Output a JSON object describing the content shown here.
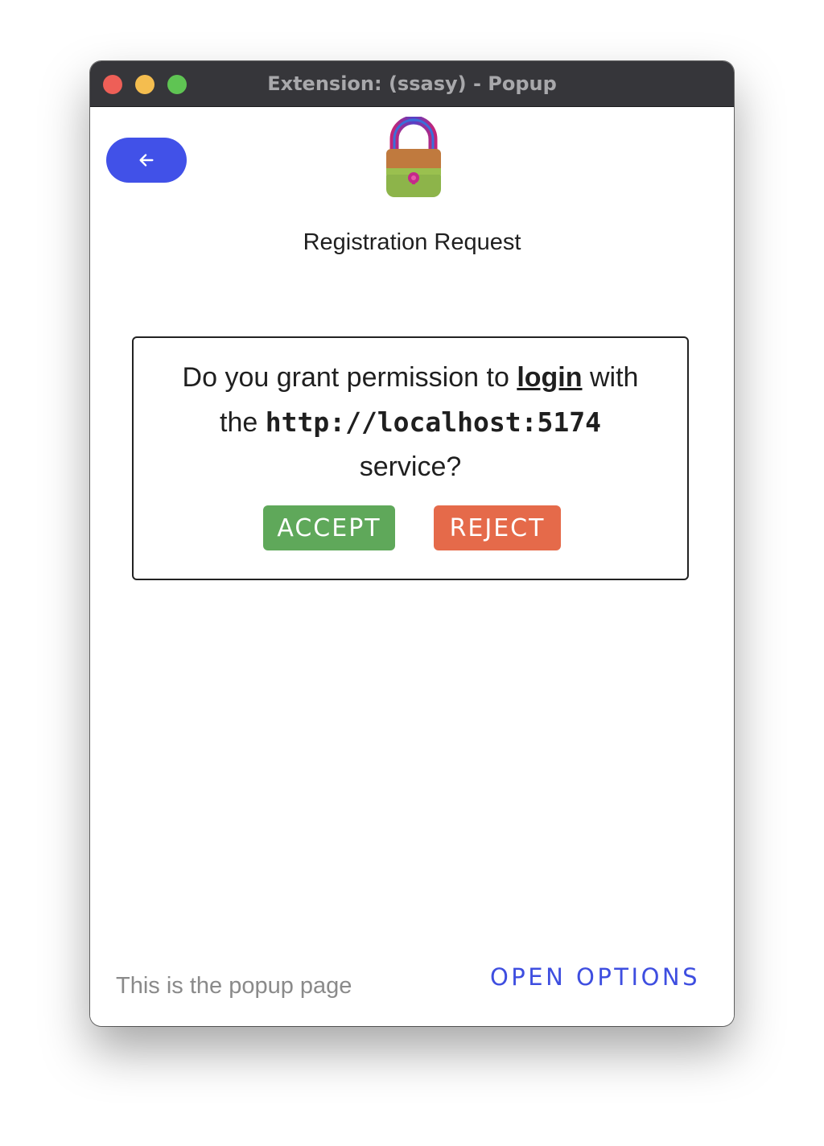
{
  "window": {
    "title": "Extension: (ssasy) - Popup"
  },
  "header": {
    "back_icon": "arrow-left-icon",
    "logo_icon": "padlock-icon",
    "heading": "Registration Request"
  },
  "dialog": {
    "question_prefix": "Do you grant permission to",
    "action": "login",
    "question_mid_1": "with",
    "question_mid_2": "the",
    "service_url": "http://localhost:5174",
    "question_suffix": "service?",
    "accept_label": "ACCEPT",
    "reject_label": "REJECT"
  },
  "footer": {
    "text": "This is the popup page",
    "options_label": "OPEN OPTIONS"
  },
  "colors": {
    "accent": "#4151e8",
    "accept": "#5fa85a",
    "reject": "#e56a4a",
    "titlebar": "#36363a"
  }
}
